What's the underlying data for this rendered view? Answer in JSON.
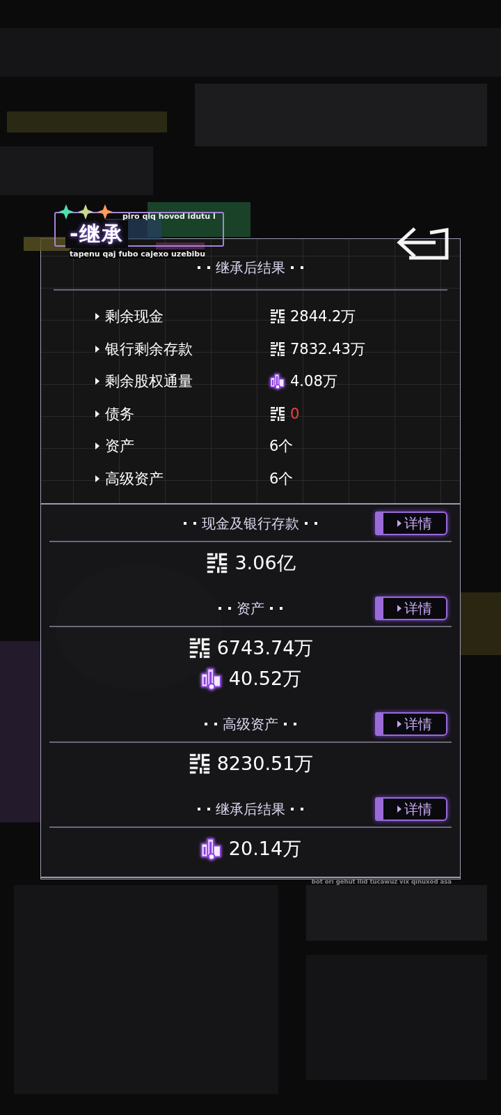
{
  "header": {
    "caption_top": "piro qiq hovod idutu l",
    "title": "-继承",
    "caption_bottom": "tapenu qaj fubo cajexo uzebibu"
  },
  "summary": {
    "title": "继承后结果",
    "rows": [
      {
        "label": "剩余现金",
        "kind": "cash",
        "value": "2844.2万",
        "alert": false
      },
      {
        "label": "银行剩余存款",
        "kind": "cash",
        "value": "7832.43万",
        "alert": false
      },
      {
        "label": "剩余股权通量",
        "kind": "equity",
        "value": "4.08万",
        "alert": false
      },
      {
        "label": "债务",
        "kind": "cash",
        "value": "0",
        "alert": true
      },
      {
        "label": "资产",
        "value": "6个",
        "alert": false
      },
      {
        "label": "高级资产",
        "value": "6个",
        "alert": false
      }
    ]
  },
  "sections": [
    {
      "title": "现金及银行存款",
      "button": "详情",
      "amounts": [
        {
          "kind": "cash",
          "value": "3.06亿"
        }
      ]
    },
    {
      "title": "资产",
      "button": "详情",
      "amounts": [
        {
          "kind": "cash",
          "value": "6743.74万"
        },
        {
          "kind": "equity",
          "value": "40.52万"
        }
      ]
    },
    {
      "title": "高级资产",
      "button": "详情",
      "amounts": [
        {
          "kind": "cash",
          "value": "8230.51万"
        }
      ]
    },
    {
      "title": "继承后结果",
      "button": "详情",
      "amounts": [
        {
          "kind": "equity",
          "value": "20.14万"
        }
      ]
    }
  ],
  "footer": "bot ori gehut llid tucawuz vix qinuxod asa"
}
